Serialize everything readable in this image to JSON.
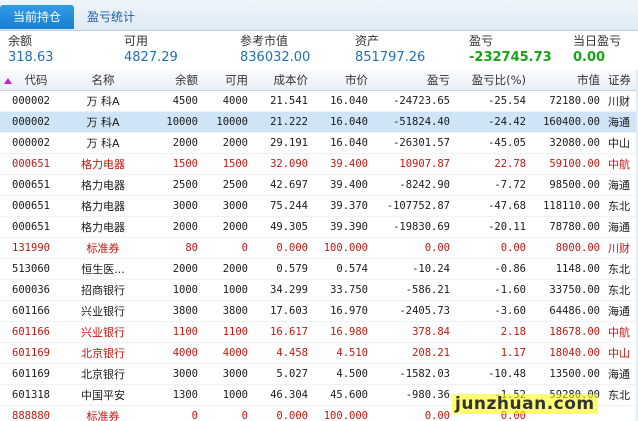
{
  "tabs": [
    {
      "label": "当前持仓"
    },
    {
      "label": "盈亏统计"
    }
  ],
  "summary": [
    {
      "label": "余额",
      "value": "318.63"
    },
    {
      "label": "可用",
      "value": "4827.29"
    },
    {
      "label": "参考市值",
      "value": "836032.00"
    },
    {
      "label": "资产",
      "value": "851797.26"
    },
    {
      "label": "盈亏",
      "value": "-232745.73"
    },
    {
      "label": "当日盈亏",
      "value": "0.00"
    }
  ],
  "table": {
    "columns": [
      "代码",
      "名称",
      "余额",
      "可用",
      "成本价",
      "市价",
      "盈亏",
      "盈亏比(%)",
      "市值",
      "证券"
    ],
    "rows": [
      {
        "code": "000002",
        "name": "万 科A",
        "balance": "4500",
        "available": "4000",
        "cost": "21.541",
        "price": "16.040",
        "pl": "-24723.65",
        "pl_pct": "-25.54",
        "value": "72180.00",
        "account": "川财"
      },
      {
        "code": "000002",
        "name": "万 科A",
        "balance": "10000",
        "available": "10000",
        "cost": "21.222",
        "price": "16.040",
        "pl": "-51824.40",
        "pl_pct": "-24.42",
        "value": "160400.00",
        "account": "海通"
      },
      {
        "code": "000002",
        "name": "万 科A",
        "balance": "2000",
        "available": "2000",
        "cost": "29.191",
        "price": "16.040",
        "pl": "-26301.57",
        "pl_pct": "-45.05",
        "value": "32080.00",
        "account": "中山"
      },
      {
        "code": "000651",
        "name": "格力电器",
        "balance": "1500",
        "available": "1500",
        "cost": "32.090",
        "price": "39.400",
        "pl": "10907.87",
        "pl_pct": "22.78",
        "value": "59100.00",
        "account": "中航"
      },
      {
        "code": "000651",
        "name": "格力电器",
        "balance": "2500",
        "available": "2500",
        "cost": "42.697",
        "price": "39.400",
        "pl": "-8242.90",
        "pl_pct": "-7.72",
        "value": "98500.00",
        "account": "海通"
      },
      {
        "code": "000651",
        "name": "格力电器",
        "balance": "3000",
        "available": "3000",
        "cost": "75.244",
        "price": "39.370",
        "pl": "-107752.87",
        "pl_pct": "-47.68",
        "value": "118110.00",
        "account": "东北"
      },
      {
        "code": "000651",
        "name": "格力电器",
        "balance": "2000",
        "available": "2000",
        "cost": "49.305",
        "price": "39.390",
        "pl": "-19830.69",
        "pl_pct": "-20.11",
        "value": "78780.00",
        "account": "海通"
      },
      {
        "code": "131990",
        "name": "标准券",
        "balance": "80",
        "available": "0",
        "cost": "0.000",
        "price": "100.000",
        "pl": "0.00",
        "pl_pct": "0.00",
        "value": "8000.00",
        "account": "川财"
      },
      {
        "code": "513060",
        "name": "恒生医...",
        "balance": "2000",
        "available": "2000",
        "cost": "0.579",
        "price": "0.574",
        "pl": "-10.24",
        "pl_pct": "-0.86",
        "value": "1148.00",
        "account": "东北"
      },
      {
        "code": "600036",
        "name": "招商银行",
        "balance": "1000",
        "available": "1000",
        "cost": "34.299",
        "price": "33.750",
        "pl": "-586.21",
        "pl_pct": "-1.60",
        "value": "33750.00",
        "account": "东北"
      },
      {
        "code": "601166",
        "name": "兴业银行",
        "balance": "3800",
        "available": "3800",
        "cost": "17.603",
        "price": "16.970",
        "pl": "-2405.73",
        "pl_pct": "-3.60",
        "value": "64486.00",
        "account": "海通"
      },
      {
        "code": "601166",
        "name": "兴业银行",
        "balance": "1100",
        "available": "1100",
        "cost": "16.617",
        "price": "16.980",
        "pl": "378.84",
        "pl_pct": "2.18",
        "value": "18678.00",
        "account": "中航"
      },
      {
        "code": "601169",
        "name": "北京银行",
        "balance": "4000",
        "available": "4000",
        "cost": "4.458",
        "price": "4.510",
        "pl": "208.21",
        "pl_pct": "1.17",
        "value": "18040.00",
        "account": "中山"
      },
      {
        "code": "601169",
        "name": "北京银行",
        "balance": "3000",
        "available": "3000",
        "cost": "5.027",
        "price": "4.500",
        "pl": "-1582.03",
        "pl_pct": "-10.48",
        "value": "13500.00",
        "account": "海通"
      },
      {
        "code": "601318",
        "name": "中国平安",
        "balance": "1300",
        "available": "1000",
        "cost": "46.304",
        "price": "45.600",
        "pl": "-980.36",
        "pl_pct": "-1.52",
        "value": "59280.00",
        "account": "东北"
      },
      {
        "code": "888880",
        "name": "标准券",
        "balance": "0",
        "available": "0",
        "cost": "0.000",
        "price": "100.000",
        "pl": "0.00",
        "pl_pct": "0.00",
        "value": "",
        "account": ""
      }
    ]
  },
  "watermark": "junzhuan.com",
  "colors": {
    "accent": "#1b7fd1",
    "selected_row": "#cfe4f7",
    "profit_red": "#c3160f",
    "link_blue": "#1f6fb5",
    "zero_green": "#17a317"
  }
}
